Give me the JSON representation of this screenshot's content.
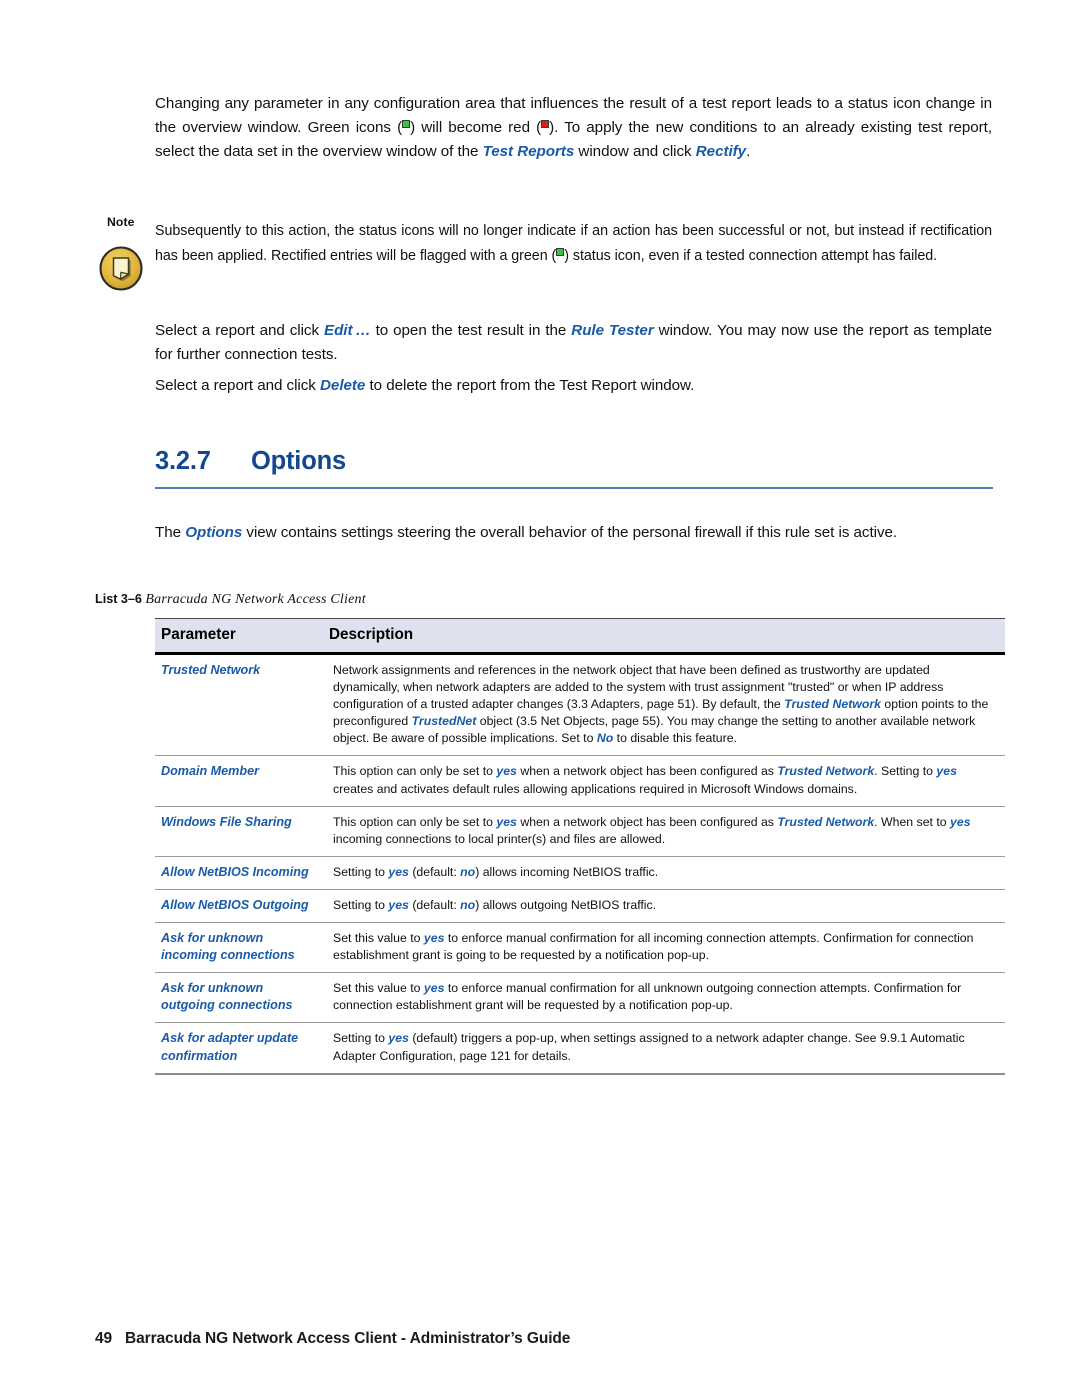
{
  "intro_paragraph": {
    "part1": "Changing any parameter in any configuration area that influences the result of a test report leads to a status icon change in the overview window. Green icons (",
    "part2": ") will become red (",
    "part3": "). To apply the new conditions to an already existing test report, select the data set in the overview window of the ",
    "emphasis1": "Test Reports",
    "part4": " window and click ",
    "emphasis2": "Rectify",
    "part5": "."
  },
  "note": {
    "label": "Note",
    "icon": "note-page-icon",
    "part1": "Subsequently to this action, the status icons will no longer indicate if an action has been successful or not, but instead if rectification has been applied. Rectified entries will be flagged with a green (",
    "part2": ") status icon, even if a tested connection attempt has failed."
  },
  "paragraph_edit": {
    "part1": "Select a report and click ",
    "emphasis1": "Edit …",
    "part2": " to open the test result in the ",
    "emphasis2": "Rule Tester",
    "part3": " window. You may now use the report as template for further connection tests."
  },
  "paragraph_delete": {
    "part1": "Select a report and click ",
    "emphasis1": "Delete",
    "part2": " to delete the report from the Test Report window."
  },
  "section": {
    "number": "3.2.7",
    "title": "Options"
  },
  "options_paragraph": {
    "part1": "The ",
    "emphasis1": "Options",
    "part2": " view contains settings steering the overall behavior of the personal firewall if this rule set is active."
  },
  "table": {
    "caption_label": "List 3–6",
    "caption_title": "Barracuda NG Network Access Client",
    "headers": [
      "Parameter",
      "Description"
    ],
    "rows": [
      {
        "parameter": "Trusted Network",
        "description_segments": [
          {
            "t": "Network assignments and references in the network object that have been defined as trustworthy are updated dynamically, when network adapters are added to the system with trust assignment \"trusted\" or when IP address configuration of a trusted adapter changes (3.3 Adapters, page 51). By default, the ",
            "s": "n"
          },
          {
            "t": "Trusted Network",
            "s": "b"
          },
          {
            "t": " option points to the preconfigured ",
            "s": "n"
          },
          {
            "t": "TrustedNet",
            "s": "b"
          },
          {
            "t": " object (3.5 Net Objects, page 55). You may change the setting to another available network object. Be aware of possible implications. Set to ",
            "s": "n"
          },
          {
            "t": "No",
            "s": "b"
          },
          {
            "t": " to disable this feature.",
            "s": "n"
          }
        ]
      },
      {
        "parameter": "Domain Member",
        "description_segments": [
          {
            "t": "This option can only be set to ",
            "s": "n"
          },
          {
            "t": "yes",
            "s": "b"
          },
          {
            "t": " when a network object has been configured as ",
            "s": "n"
          },
          {
            "t": "Trusted Network",
            "s": "b"
          },
          {
            "t": ". Setting to ",
            "s": "n"
          },
          {
            "t": "yes",
            "s": "b"
          },
          {
            "t": " creates and activates default rules allowing applications required in Microsoft Windows domains.",
            "s": "n"
          }
        ]
      },
      {
        "parameter": "Windows File Sharing",
        "description_segments": [
          {
            "t": "This option can only be set to ",
            "s": "n"
          },
          {
            "t": "yes",
            "s": "b"
          },
          {
            "t": " when a network object has been configured as ",
            "s": "n"
          },
          {
            "t": "Trusted Network",
            "s": "b"
          },
          {
            "t": ". When set to ",
            "s": "n"
          },
          {
            "t": "yes",
            "s": "b"
          },
          {
            "t": " incoming connections to local printer(s) and files are allowed.",
            "s": "n"
          }
        ]
      },
      {
        "parameter": "Allow NetBIOS Incoming",
        "description_segments": [
          {
            "t": "Setting to ",
            "s": "n"
          },
          {
            "t": "yes",
            "s": "b"
          },
          {
            "t": " (default: ",
            "s": "n"
          },
          {
            "t": "no",
            "s": "b"
          },
          {
            "t": ") allows incoming NetBIOS traffic.",
            "s": "n"
          }
        ]
      },
      {
        "parameter": "Allow NetBIOS Outgoing",
        "description_segments": [
          {
            "t": "Setting to ",
            "s": "n"
          },
          {
            "t": "yes",
            "s": "b"
          },
          {
            "t": " (default: ",
            "s": "n"
          },
          {
            "t": "no",
            "s": "b"
          },
          {
            "t": ") allows outgoing NetBIOS traffic.",
            "s": "n"
          }
        ]
      },
      {
        "parameter": "Ask for unknown incoming connections",
        "description_segments": [
          {
            "t": "Set this value to ",
            "s": "n"
          },
          {
            "t": "yes",
            "s": "b"
          },
          {
            "t": " to enforce manual confirmation for all incoming connection attempts. Confirmation for connection establishment grant is going to be requested by a notification pop-up.",
            "s": "n"
          }
        ]
      },
      {
        "parameter": "Ask for unknown outgoing connections",
        "description_segments": [
          {
            "t": "Set this value to ",
            "s": "n"
          },
          {
            "t": "yes",
            "s": "b"
          },
          {
            "t": " to enforce manual confirmation for all unknown outgoing connection attempts. Confirmation for connection establishment grant will be requested by a notification pop-up.",
            "s": "n"
          }
        ]
      },
      {
        "parameter": "Ask for adapter update confirmation",
        "description_segments": [
          {
            "t": "Setting to ",
            "s": "n"
          },
          {
            "t": "yes",
            "s": "b"
          },
          {
            "t": " (default) triggers a pop-up, when settings assigned to a network adapter change. See 9.9.1 Automatic Adapter Configuration, page 121 for details.",
            "s": "n"
          }
        ]
      }
    ]
  },
  "footer": {
    "page_number": "49",
    "title": "Barracuda NG Network Access Client - Administrator’s Guide"
  },
  "colors": {
    "heading_blue": "#14478f",
    "rule_blue": "#4f7fc0",
    "emphasis_blue": "#1a5ba6",
    "header_bg": "#dfe2ee",
    "status_green": "#3ec13e",
    "status_red": "#e01b1b",
    "note_gold": "#e0b73c"
  }
}
